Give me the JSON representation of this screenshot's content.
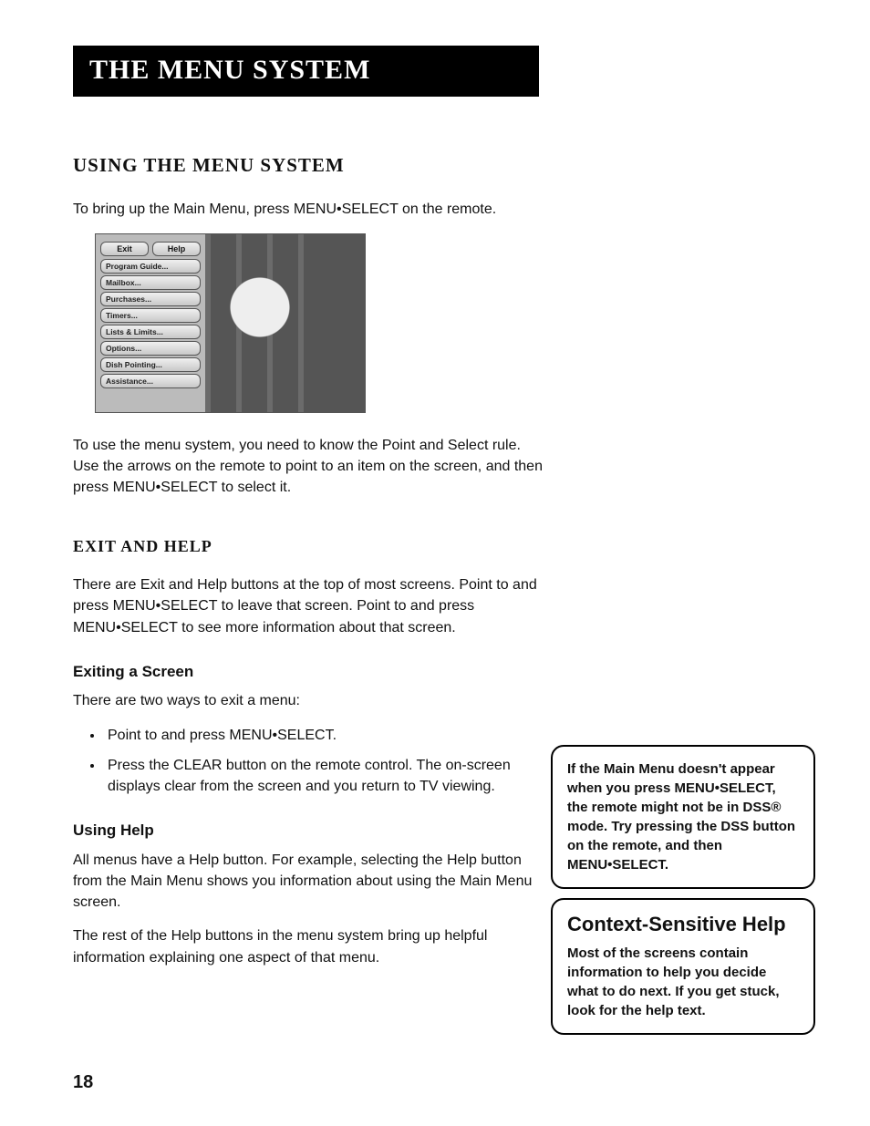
{
  "banner": "The Menu System",
  "section1": {
    "heading": "Using the Menu System",
    "intro": "To bring up the Main Menu, press MENU•SELECT on the remote.",
    "para2": "To use the menu system, you need to know the Point and Select rule.   Use the arrows on the remote to point to an item on the screen, and then press MENU•SELECT to select it."
  },
  "menu": {
    "exit": "Exit",
    "help": "Help",
    "items": [
      "Program Guide...",
      "Mailbox...",
      "Purchases...",
      "Timers...",
      "Lists & Limits...",
      "Options...",
      "Dish Pointing...",
      "Assistance..."
    ]
  },
  "section2": {
    "heading": "Exit and Help",
    "para": "There are Exit and Help buttons at the top of most screens.  Point to        and press MENU•SELECT to leave that screen.  Point to         and press MENU•SELECT to see more information about that screen."
  },
  "exitScreen": {
    "heading": "Exiting a Screen",
    "intro": "There are two ways to exit a menu:",
    "b1": "Point to        and press MENU•SELECT.",
    "b2": "Press the CLEAR button on the remote control. The on-screen displays clear from the screen and you return to TV viewing."
  },
  "usingHelp": {
    "heading": "Using Help",
    "p1": "All menus have a Help button. For example, selecting the Help button from the Main Menu shows you information about using the Main Menu screen.",
    "p2": "The rest of the Help buttons in the menu system bring up helpful information explaining one aspect of that menu."
  },
  "note1": "If the Main Menu doesn't appear when you press MENU•SELECT, the remote might not be in DSS® mode. Try pressing the DSS button on the remote, and then MENU•SELECT.",
  "note2": {
    "title": "Context-Sensitive Help",
    "txt": "Most of the screens contain information to help you decide what to do next. If you get stuck, look for the help text."
  },
  "pageNumber": "18"
}
